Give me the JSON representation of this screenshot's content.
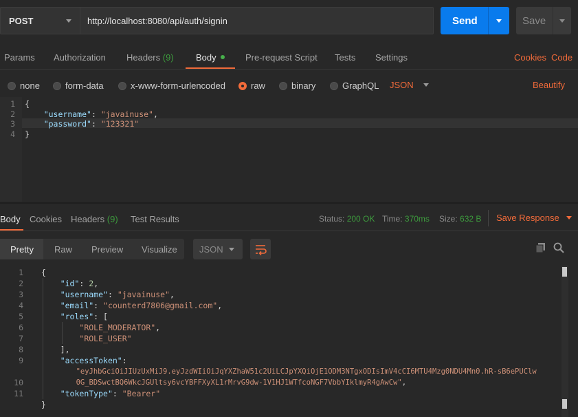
{
  "request": {
    "method": "POST",
    "url": "http://localhost:8080/api/auth/signin",
    "send_label": "Send",
    "save_label": "Save"
  },
  "request_tabs": {
    "params": "Params",
    "authorization": "Authorization",
    "headers": "Headers",
    "headers_count": "(9)",
    "body": "Body",
    "prerequest": "Pre-request Script",
    "tests": "Tests",
    "settings": "Settings",
    "cookies": "Cookies",
    "code": "Code"
  },
  "body_types": {
    "none": "none",
    "form_data": "form-data",
    "urlencoded": "x-www-form-urlencoded",
    "raw": "raw",
    "binary": "binary",
    "graphql": "GraphQL",
    "format": "JSON",
    "beautify": "Beautify"
  },
  "request_body": {
    "line_numbers": [
      "1",
      "2",
      "3",
      "4"
    ],
    "l1": "{",
    "k_username": "\"username\"",
    "v_username": "\"javainuse\"",
    "k_password": "\"password\"",
    "v_password": "\"123321\"",
    "l4": "}"
  },
  "response_tabs": {
    "body": "Body",
    "cookies": "Cookies",
    "headers": "Headers",
    "headers_count": "(9)",
    "test_results": "Test Results"
  },
  "response_status": {
    "status_label": "Status:",
    "status_value": "200 OK",
    "time_label": "Time:",
    "time_value": "370ms",
    "size_label": "Size:",
    "size_value": "632 B",
    "save_response": "Save Response"
  },
  "view_modes": {
    "pretty": "Pretty",
    "raw": "Raw",
    "preview": "Preview",
    "visualize": "Visualize",
    "format": "JSON"
  },
  "response_body": {
    "line_numbers": [
      "1",
      "2",
      "3",
      "4",
      "5",
      "6",
      "7",
      "8",
      "9",
      "10",
      "11"
    ],
    "open": "{",
    "k_id": "\"id\"",
    "v_id": "2",
    "k_username": "\"username\"",
    "v_username": "\"javainuse\"",
    "k_email": "\"email\"",
    "v_email": "\"counterd7806@gmail.com\"",
    "k_roles": "\"roles\"",
    "role1": "\"ROLE_MODERATOR\"",
    "role2": "\"ROLE_USER\"",
    "k_access": "\"accessToken\"",
    "token_line1": "\"eyJhbGciOiJIUzUxMiJ9.eyJzdWIiOiJqYXZhaW51c2UiLCJpYXQiOjE1ODM3NTgxODIsImV4cCI6MTU4Mzg0NDU4Mn0.hR-sB6ePUClw",
    "token_line2": "0G_BDSwctBQ6WkcJGUltsy6vcYBFFXyXL1rMrvG9dw-1V1HJ1WTfcoNGF7VbbYIklmyR4gAwCw\"",
    "k_tokentype": "\"tokenType\"",
    "v_tokentype": "\"Bearer\"",
    "close": "}"
  }
}
